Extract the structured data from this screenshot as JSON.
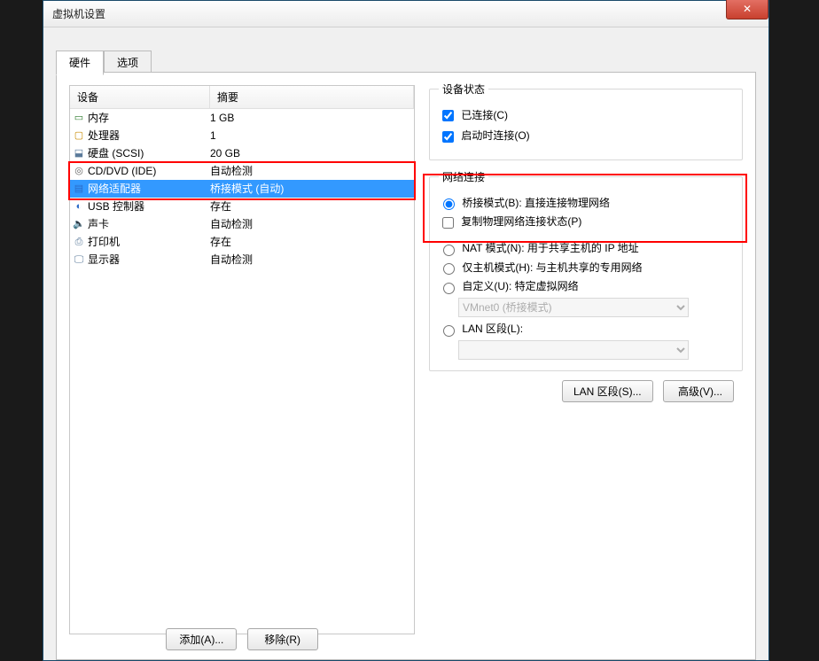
{
  "window": {
    "title": "虚拟机设置"
  },
  "tabs": {
    "hardware": "硬件",
    "options": "选项"
  },
  "list": {
    "hdr_device": "设备",
    "hdr_summary": "摘要",
    "rows": [
      {
        "icon": "▭",
        "cls": "ic-mem",
        "name": "内存",
        "summary": "1 GB"
      },
      {
        "icon": "▢",
        "cls": "ic-cpu",
        "name": "处理器",
        "summary": "1"
      },
      {
        "icon": "⬓",
        "cls": "ic-hdd",
        "name": "硬盘 (SCSI)",
        "summary": "20 GB"
      },
      {
        "icon": "◎",
        "cls": "ic-cd",
        "name": "CD/DVD (IDE)",
        "summary": "自动检测"
      },
      {
        "icon": "▤",
        "cls": "ic-net",
        "name": "网络适配器",
        "summary": "桥接模式 (自动)"
      },
      {
        "icon": "◐",
        "cls": "ic-usb",
        "name": "USB 控制器",
        "summary": "存在"
      },
      {
        "icon": "🔈",
        "cls": "ic-snd",
        "name": "声卡",
        "summary": "自动检测"
      },
      {
        "icon": "⎙",
        "cls": "ic-prn",
        "name": "打印机",
        "summary": "存在"
      },
      {
        "icon": "🖵",
        "cls": "ic-mon",
        "name": "显示器",
        "summary": "自动检测"
      }
    ]
  },
  "buttons": {
    "add": "添加(A)...",
    "remove": "移除(R)"
  },
  "status_group": {
    "legend": "设备状态",
    "connected": "已连接(C)",
    "connect_at_power": "启动时连接(O)"
  },
  "net_group": {
    "legend": "网络连接",
    "bridged": "桥接模式(B): 直接连接物理网络",
    "replicate": "复制物理网络连接状态(P)",
    "nat": "NAT 模式(N): 用于共享主机的 IP 地址",
    "hostonly": "仅主机模式(H): 与主机共享的专用网络",
    "custom": "自定义(U): 特定虚拟网络",
    "custom_select": "VMnet0 (桥接模式)",
    "lan": "LAN 区段(L):",
    "lan_select": ""
  },
  "right_buttons": {
    "lan_seg": "LAN 区段(S)...",
    "advanced": "高级(V)..."
  }
}
